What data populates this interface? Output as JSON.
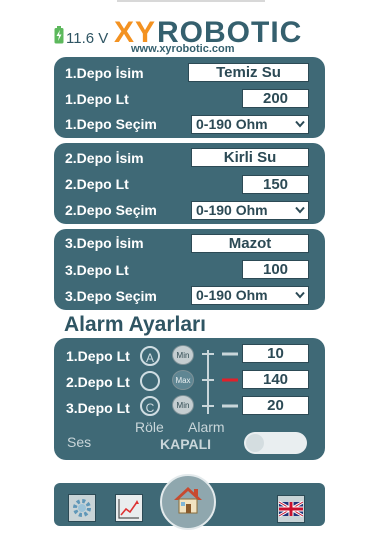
{
  "header": {
    "voltage": "11.6 V",
    "brand_xy": "XY",
    "brand_robotic": "ROBOTIC",
    "website": "www.xyrobotic.com",
    "battery_color": "#5cb85c"
  },
  "tanks": [
    {
      "name_label": "1.Depo İsim",
      "name_value": "Temiz Su",
      "lt_label": "1.Depo Lt",
      "lt_value": "200",
      "sel_label": "1.Depo Seçim",
      "sel_value": "0-190 Ohm"
    },
    {
      "name_label": "2.Depo İsim",
      "name_value": "Kirli Su",
      "lt_label": "2.Depo Lt",
      "lt_value": "150",
      "sel_label": "2.Depo Seçim",
      "sel_value": "0-190 Ohm"
    },
    {
      "name_label": "3.Depo İsim",
      "name_value": "Mazot",
      "lt_label": "3.Depo Lt",
      "lt_value": "100",
      "sel_label": "3.Depo Seçim",
      "sel_value": "0-190 Ohm"
    }
  ],
  "alarm": {
    "title": "Alarm Ayarları",
    "rows": [
      {
        "label": "1.Depo Lt",
        "relay": "A",
        "mode": "Min",
        "value": "10"
      },
      {
        "label": "2.Depo Lt",
        "relay": "",
        "mode": "Max",
        "value": "140"
      },
      {
        "label": "3.Depo Lt",
        "relay": "C",
        "mode": "Min",
        "value": "20"
      }
    ],
    "relay_caption": "Röle",
    "alarm_caption": "Alarm",
    "sound_label": "Ses",
    "sound_state": "KAPALI",
    "sound_on": false,
    "alert_color": "#e0202a"
  },
  "footer": {
    "settings_icon": "gear-icon",
    "chart_icon": "chart-icon",
    "home_icon": "home-icon",
    "language_icon": "uk-flag-icon"
  }
}
